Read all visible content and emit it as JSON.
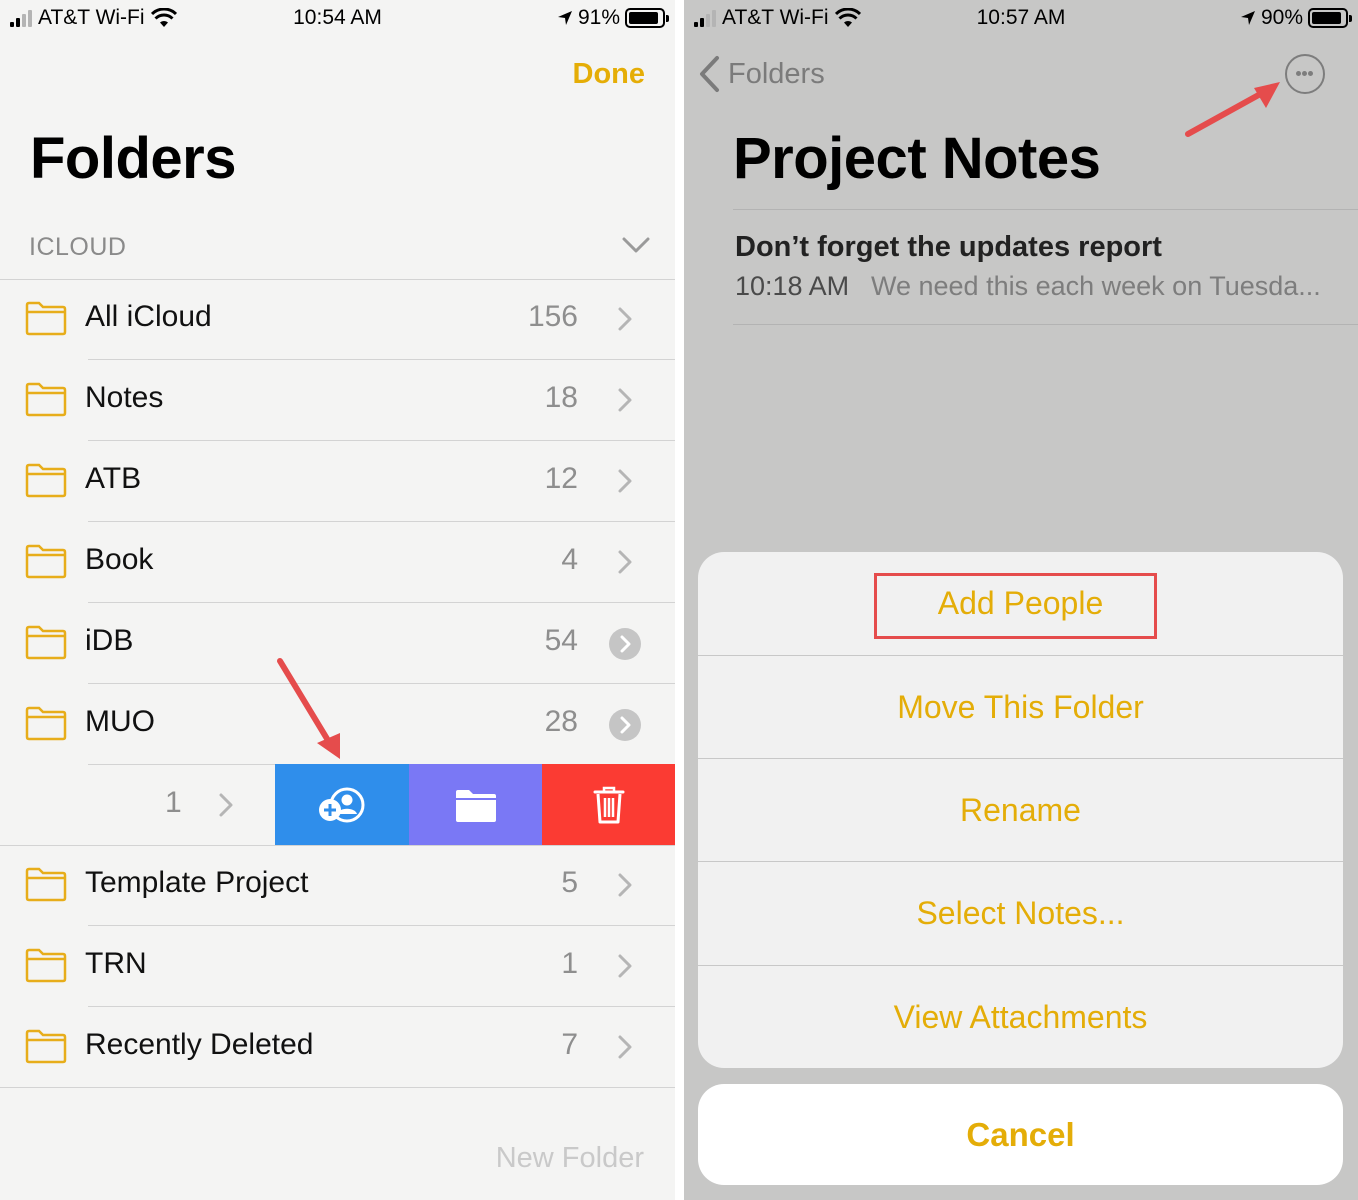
{
  "left": {
    "status": {
      "carrier": "AT&T Wi-Fi",
      "time": "10:54 AM",
      "battery": "91%",
      "battery_level": 0.91
    },
    "done_label": "Done",
    "title": "Folders",
    "section_label": "ICLOUD",
    "folders": [
      {
        "name": "All iCloud",
        "count": "156"
      },
      {
        "name": "Notes",
        "count": "18"
      },
      {
        "name": "ATB",
        "count": "12"
      },
      {
        "name": "Book",
        "count": "4"
      },
      {
        "name": "iDB",
        "count": "54"
      },
      {
        "name": "MUO",
        "count": "28"
      }
    ],
    "swiped_row": {
      "count": "1",
      "actions": [
        "add-people-icon",
        "folder-icon",
        "trash-icon"
      ]
    },
    "folders_after": [
      {
        "name": "Template Project",
        "count": "5"
      },
      {
        "name": "TRN",
        "count": "1"
      },
      {
        "name": "Recently Deleted",
        "count": "7"
      }
    ],
    "new_folder_label": "New Folder"
  },
  "right": {
    "status": {
      "carrier": "AT&T Wi-Fi",
      "time": "10:57 AM",
      "battery": "90%",
      "battery_level": 0.9
    },
    "back_label": "Folders",
    "title": "Project Notes",
    "note": {
      "title": "Don’t forget the updates report",
      "time": "10:18 AM",
      "preview": "We need this each week on Tuesda..."
    },
    "sheet_options": [
      "Add People",
      "Move This Folder",
      "Rename",
      "Select Notes...",
      "View Attachments"
    ],
    "cancel_label": "Cancel"
  },
  "colors": {
    "accent": "#e4ad08",
    "share": "#2f8eeb",
    "move": "#7a78f5",
    "delete": "#fb3b33",
    "annotation": "#e54c4c"
  }
}
